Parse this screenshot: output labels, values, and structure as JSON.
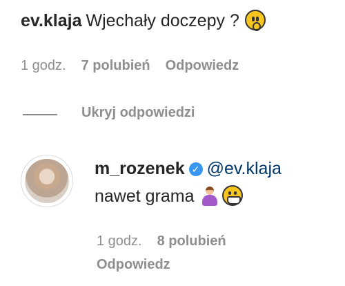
{
  "comment": {
    "username": "ev.klaja",
    "text": "Wjechały doczepy ?",
    "emoji": "astonished-face-emoji",
    "time": "1 godz.",
    "likes": "7 polubień",
    "reply_label": "Odpowiedz"
  },
  "replies_toggle": {
    "label": "Ukryj odpowiedzi"
  },
  "reply": {
    "username": "m_rozenek",
    "verified_icon": "verified-badge-icon",
    "mention": "@ev.klaja",
    "text": "nawet grama",
    "emojis": [
      "person-shrugging-emoji",
      "grinning-face-emoji"
    ],
    "time": "1 godz.",
    "likes": "8 polubień",
    "reply_label": "Odpowiedz"
  },
  "colors": {
    "text": "#262626",
    "secondary": "#8e8e8e",
    "mention": "#00376b",
    "verified": "#3897f0"
  }
}
